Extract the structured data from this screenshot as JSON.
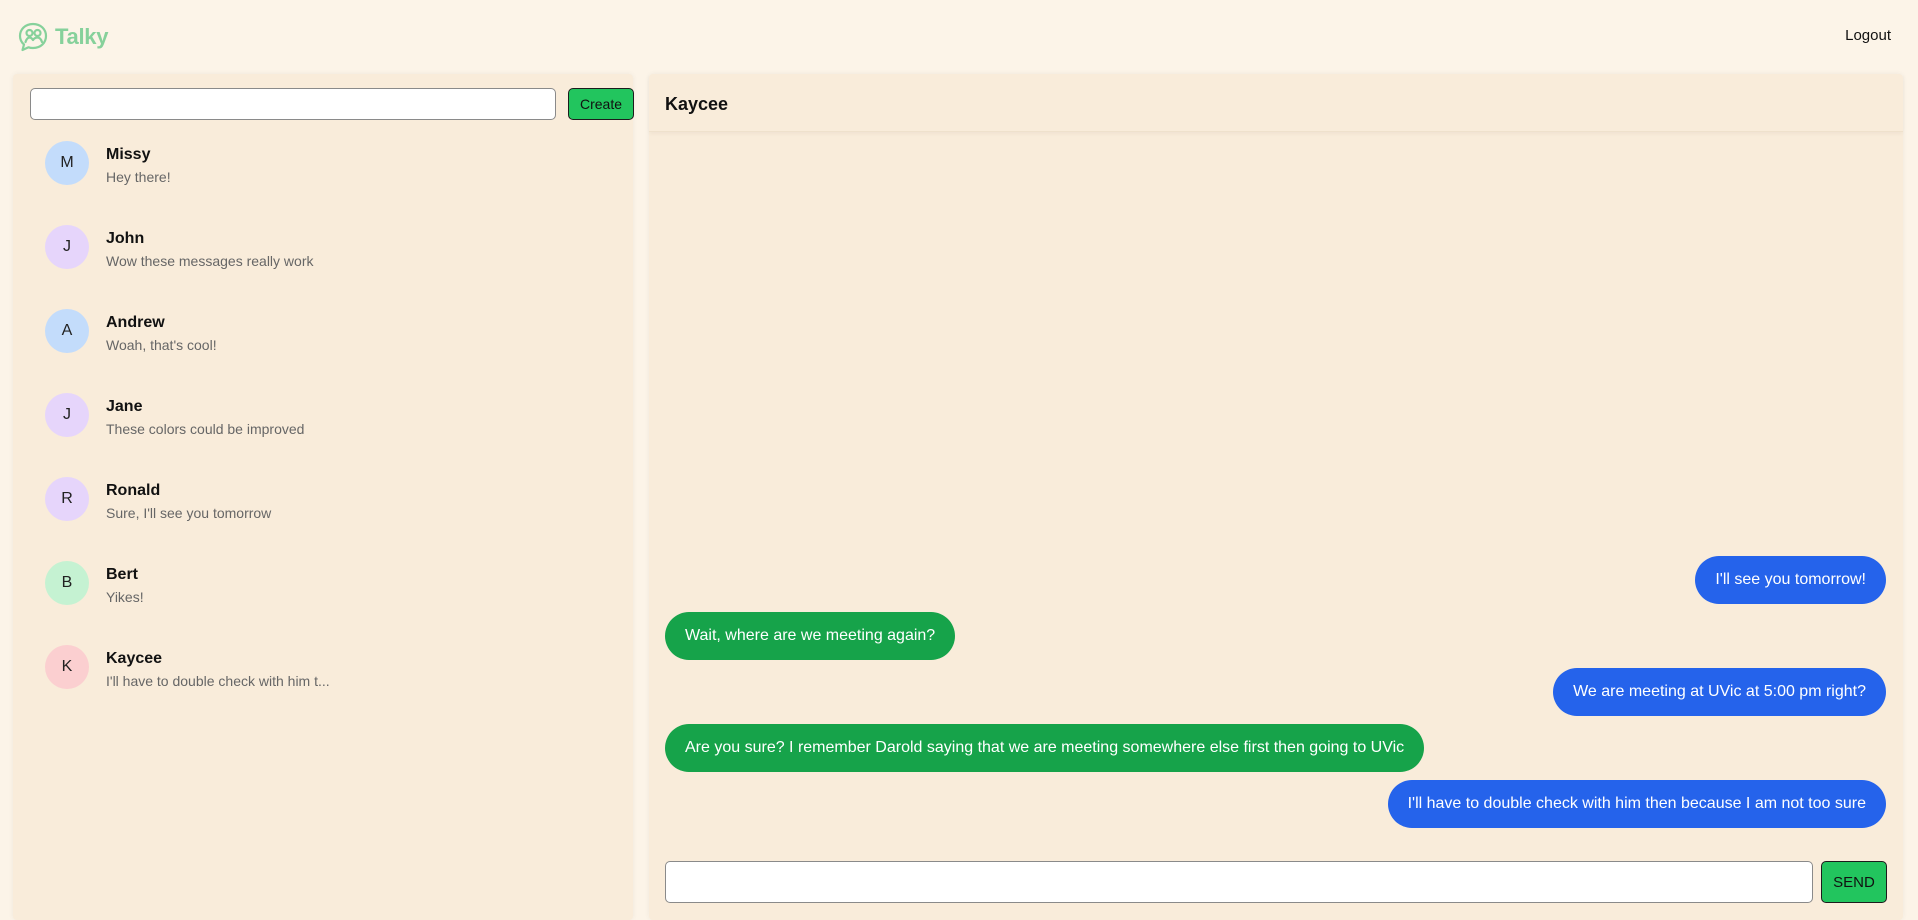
{
  "app": {
    "name": "Talky",
    "logo_icon": "chat-bubbles-icon",
    "brand_color": "#86d19b"
  },
  "header": {
    "logout_label": "Logout"
  },
  "sidebar": {
    "create_input": {
      "value": "",
      "placeholder": ""
    },
    "create_label": "Create",
    "conversations": [
      {
        "initial": "M",
        "name": "Missy",
        "preview": "Hey there!",
        "avatar_color": "#c3dcfb"
      },
      {
        "initial": "J",
        "name": "John",
        "preview": "Wow these messages really work",
        "avatar_color": "#e6d5fb"
      },
      {
        "initial": "A",
        "name": "Andrew",
        "preview": "Woah, that's cool!",
        "avatar_color": "#c3dcfb"
      },
      {
        "initial": "J",
        "name": "Jane",
        "preview": "These colors could be improved",
        "avatar_color": "#e6d5fb"
      },
      {
        "initial": "R",
        "name": "Ronald",
        "preview": "Sure, I'll see you tomorrow",
        "avatar_color": "#e6d5fb"
      },
      {
        "initial": "B",
        "name": "Bert",
        "preview": "Yikes!",
        "avatar_color": "#c5f2d2"
      },
      {
        "initial": "K",
        "name": "Kaycee",
        "preview": "I'll have to double check with him t...",
        "avatar_color": "#fbcfd0"
      }
    ]
  },
  "chat": {
    "title": "Kaycee",
    "messages": [
      {
        "direction": "out",
        "text": "I'll see you tomorrow!"
      },
      {
        "direction": "in",
        "text": "Wait, where are we meeting again?"
      },
      {
        "direction": "out",
        "text": "We are meeting at UVic at 5:00 pm right?"
      },
      {
        "direction": "in",
        "text": "Are you sure? I remember Darold saying that we are meeting somewhere else first then going to UVic"
      },
      {
        "direction": "out",
        "text": "I'll have to double check with him then because I am not too sure"
      }
    ],
    "composer": {
      "value": "",
      "placeholder": ""
    },
    "send_label": "SEND",
    "colors": {
      "outgoing": "#2563eb",
      "incoming": "#16a34a",
      "accent": "#22c55e"
    }
  }
}
